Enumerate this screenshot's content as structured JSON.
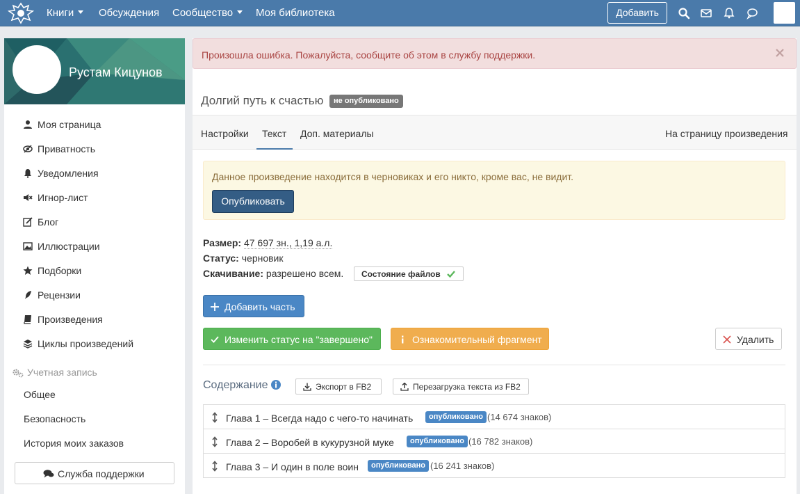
{
  "topbar": {
    "nav": [
      {
        "label": "Книги",
        "has_caret": true
      },
      {
        "label": "Обсуждения",
        "has_caret": false
      },
      {
        "label": "Сообщество",
        "has_caret": true
      },
      {
        "label": "Моя библиотека",
        "has_caret": false
      }
    ],
    "add_button": "Добавить",
    "icons": [
      "search-icon",
      "envelope-icon",
      "bell-icon",
      "chat-icon"
    ]
  },
  "sidebar": {
    "user_name": "Рустам Кицунов",
    "items": [
      {
        "label": "Моя страница",
        "icon": "user-icon"
      },
      {
        "label": "Приватность",
        "icon": "eye-slash-icon"
      },
      {
        "label": "Уведомления",
        "icon": "bell-icon"
      },
      {
        "label": "Игнор-лист",
        "icon": "volume-off-icon"
      },
      {
        "label": "Блог",
        "icon": "edit-icon"
      },
      {
        "label": "Иллюстрации",
        "icon": "picture-icon"
      },
      {
        "label": "Подборки",
        "icon": "star-icon"
      },
      {
        "label": "Рецензии",
        "icon": "quill-icon"
      },
      {
        "label": "Произведения",
        "icon": "book-icon"
      },
      {
        "label": "Циклы произведений",
        "icon": "stack-icon"
      }
    ],
    "account_section": "Учетная запись",
    "account_items": [
      "Общее",
      "Безопасность",
      "История моих заказов"
    ],
    "support_button": "Служба поддержки"
  },
  "main": {
    "error_alert": "Произошла ошибка. Пожалуйста, сообщите об этом в службу поддержки.",
    "work_title": "Долгий путь к счастью",
    "status_badge": "не опубликовано",
    "tabs": [
      "Настройки",
      "Текст",
      "Доп. материалы"
    ],
    "active_tab": "Текст",
    "tab_right_link": "На страницу произведения",
    "draft_notice": "Данное произведение находится в черновиках и его никто, кроме вас, не видит.",
    "publish_button": "Опубликовать",
    "meta": {
      "size_label": "Размер:",
      "size_value": "47 697 зн., 1,19 а.л.",
      "status_label": "Статус:",
      "status_value": "черновик",
      "download_label": "Скачивание:",
      "download_value": "разрешено всем."
    },
    "files_state_button": "Состояние файлов",
    "add_part_button": "Добавить часть",
    "complete_button": "Изменить статус на \"завершено\"",
    "fragment_button": "Ознакомительный фрагмент",
    "delete_button": "Удалить",
    "toc_title": "Содержание",
    "export_button": "Экспорт в FB2",
    "reupload_button": "Перезагрузка текста из FB2",
    "chapters": [
      {
        "title": "Глава 1 – Всегда надо с чего-то начинать",
        "badge": "опубликовано",
        "count": "(14 674 знаков)"
      },
      {
        "title": "Глава 2 – Воробей в кукурузной муке",
        "badge": "опубликовано",
        "count": "(16 782 знаков)"
      },
      {
        "title": "Глава 3 – И один в поле воин",
        "badge": "опубликовано",
        "count": "(16 241 знаков)"
      }
    ]
  },
  "colors": {
    "topbar": "#4a7aaa",
    "primary": "#4a87c5",
    "success": "#5cb85c",
    "warning": "#f0ad4e",
    "danger_text": "#a94442",
    "publish": "#345d85"
  }
}
